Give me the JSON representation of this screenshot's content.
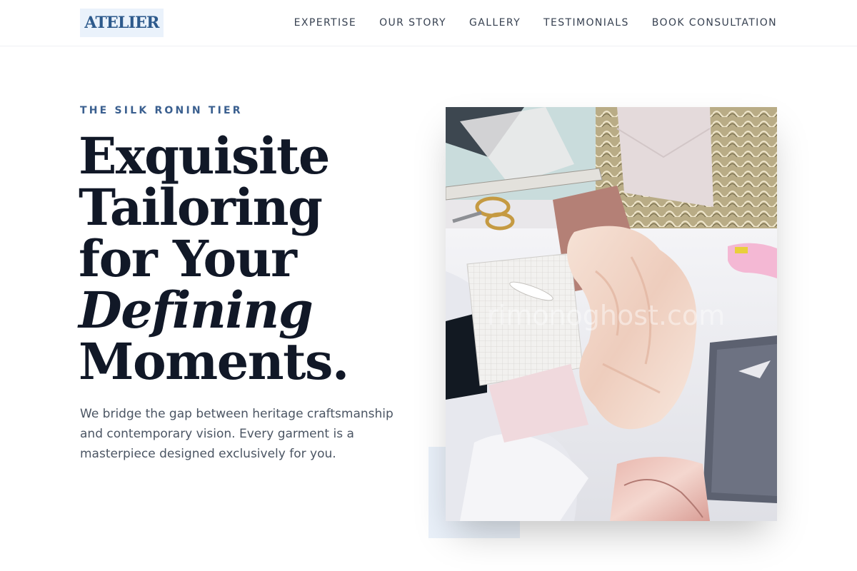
{
  "brand": {
    "logo_text": "ATELIER"
  },
  "nav": {
    "items": [
      {
        "label": "EXPERTISE"
      },
      {
        "label": "OUR STORY"
      },
      {
        "label": "GALLERY"
      },
      {
        "label": "TESTIMONIALS"
      },
      {
        "label": "BOOK CONSULTATION"
      }
    ]
  },
  "hero": {
    "eyebrow": "THE SILK RONIN TIER",
    "headline": {
      "line1": "Exquisite",
      "line2": "Tailoring",
      "line3": "for Your",
      "line4_italic": "Defining",
      "line5": "Moments."
    },
    "lede": "We bridge the gap between heritage craftsmanship and contemporary vision. Every garment is a masterpiece designed exclusively for you."
  },
  "image": {
    "subject": "flat-lay of fabrics, ruler, scissors and paper swatches",
    "watermark": "rimonoghost.com"
  },
  "colors": {
    "accent": "#3a5f8f",
    "logo_bg": "#eaf2fb",
    "text_dark": "#111827",
    "text_muted": "#4b5563"
  }
}
